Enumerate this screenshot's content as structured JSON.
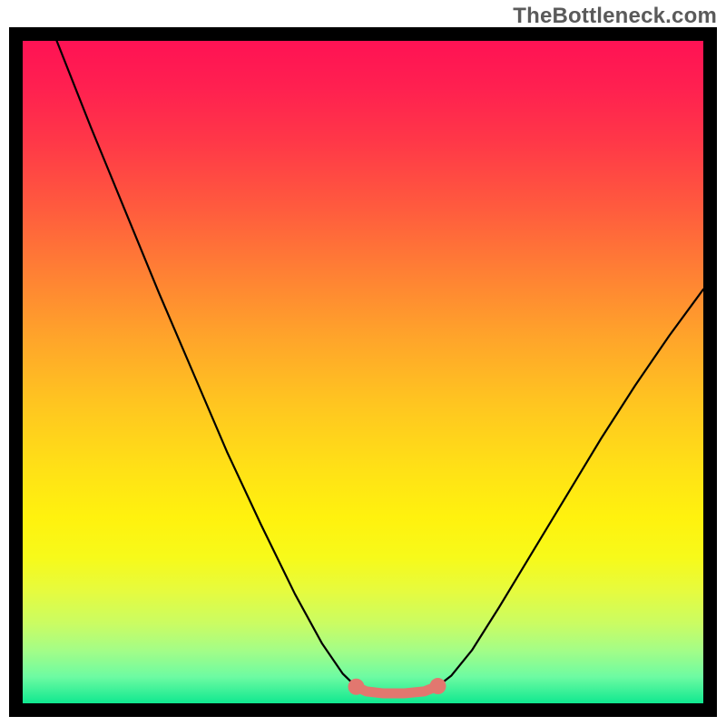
{
  "watermark": "TheBottleneck.com",
  "chart_data": {
    "type": "line",
    "title": "",
    "xlabel": "",
    "ylabel": "",
    "xlim": [
      0,
      100
    ],
    "ylim": [
      0,
      100
    ],
    "background_gradient": {
      "stops": [
        {
          "offset": 0.0,
          "color": "#ff1254"
        },
        {
          "offset": 0.07,
          "color": "#ff2050"
        },
        {
          "offset": 0.15,
          "color": "#ff3748"
        },
        {
          "offset": 0.25,
          "color": "#ff5a3e"
        },
        {
          "offset": 0.35,
          "color": "#ff8034"
        },
        {
          "offset": 0.45,
          "color": "#ffa52a"
        },
        {
          "offset": 0.55,
          "color": "#ffc620"
        },
        {
          "offset": 0.65,
          "color": "#ffe216"
        },
        {
          "offset": 0.72,
          "color": "#fff20e"
        },
        {
          "offset": 0.78,
          "color": "#f7fa1a"
        },
        {
          "offset": 0.83,
          "color": "#e6fb3e"
        },
        {
          "offset": 0.88,
          "color": "#cafc63"
        },
        {
          "offset": 0.92,
          "color": "#a4fd87"
        },
        {
          "offset": 0.96,
          "color": "#6dfba2"
        },
        {
          "offset": 1.0,
          "color": "#10e890"
        }
      ]
    },
    "series": [
      {
        "name": "curve",
        "type": "line",
        "stroke": "#000000",
        "stroke_width": 2.2,
        "points": [
          {
            "x": 5.0,
            "y": 100.0
          },
          {
            "x": 10.0,
            "y": 87.0
          },
          {
            "x": 15.0,
            "y": 74.5
          },
          {
            "x": 20.0,
            "y": 62.0
          },
          {
            "x": 25.0,
            "y": 50.0
          },
          {
            "x": 30.0,
            "y": 38.0
          },
          {
            "x": 35.0,
            "y": 27.0
          },
          {
            "x": 40.0,
            "y": 16.5
          },
          {
            "x": 44.0,
            "y": 9.0
          },
          {
            "x": 47.0,
            "y": 4.5
          },
          {
            "x": 49.0,
            "y": 2.5
          },
          {
            "x": 50.5,
            "y": 1.8
          },
          {
            "x": 53.0,
            "y": 1.5
          },
          {
            "x": 56.0,
            "y": 1.5
          },
          {
            "x": 59.0,
            "y": 1.8
          },
          {
            "x": 61.0,
            "y": 2.6
          },
          {
            "x": 63.0,
            "y": 4.2
          },
          {
            "x": 66.0,
            "y": 8.0
          },
          {
            "x": 70.0,
            "y": 14.5
          },
          {
            "x": 75.0,
            "y": 23.0
          },
          {
            "x": 80.0,
            "y": 31.5
          },
          {
            "x": 85.0,
            "y": 40.0
          },
          {
            "x": 90.0,
            "y": 48.0
          },
          {
            "x": 95.0,
            "y": 55.5
          },
          {
            "x": 100.0,
            "y": 62.5
          }
        ]
      },
      {
        "name": "valley-highlight",
        "type": "line",
        "stroke": "#e2776f",
        "stroke_width": 11,
        "points": [
          {
            "x": 49.0,
            "y": 2.5
          },
          {
            "x": 50.5,
            "y": 1.8
          },
          {
            "x": 53.0,
            "y": 1.5
          },
          {
            "x": 56.0,
            "y": 1.5
          },
          {
            "x": 59.0,
            "y": 1.8
          },
          {
            "x": 61.0,
            "y": 2.6
          }
        ]
      },
      {
        "name": "valley-endpoints",
        "type": "scatter",
        "fill": "#e2776f",
        "radius": 9,
        "points": [
          {
            "x": 49.0,
            "y": 2.5
          },
          {
            "x": 61.0,
            "y": 2.6
          }
        ]
      }
    ]
  }
}
